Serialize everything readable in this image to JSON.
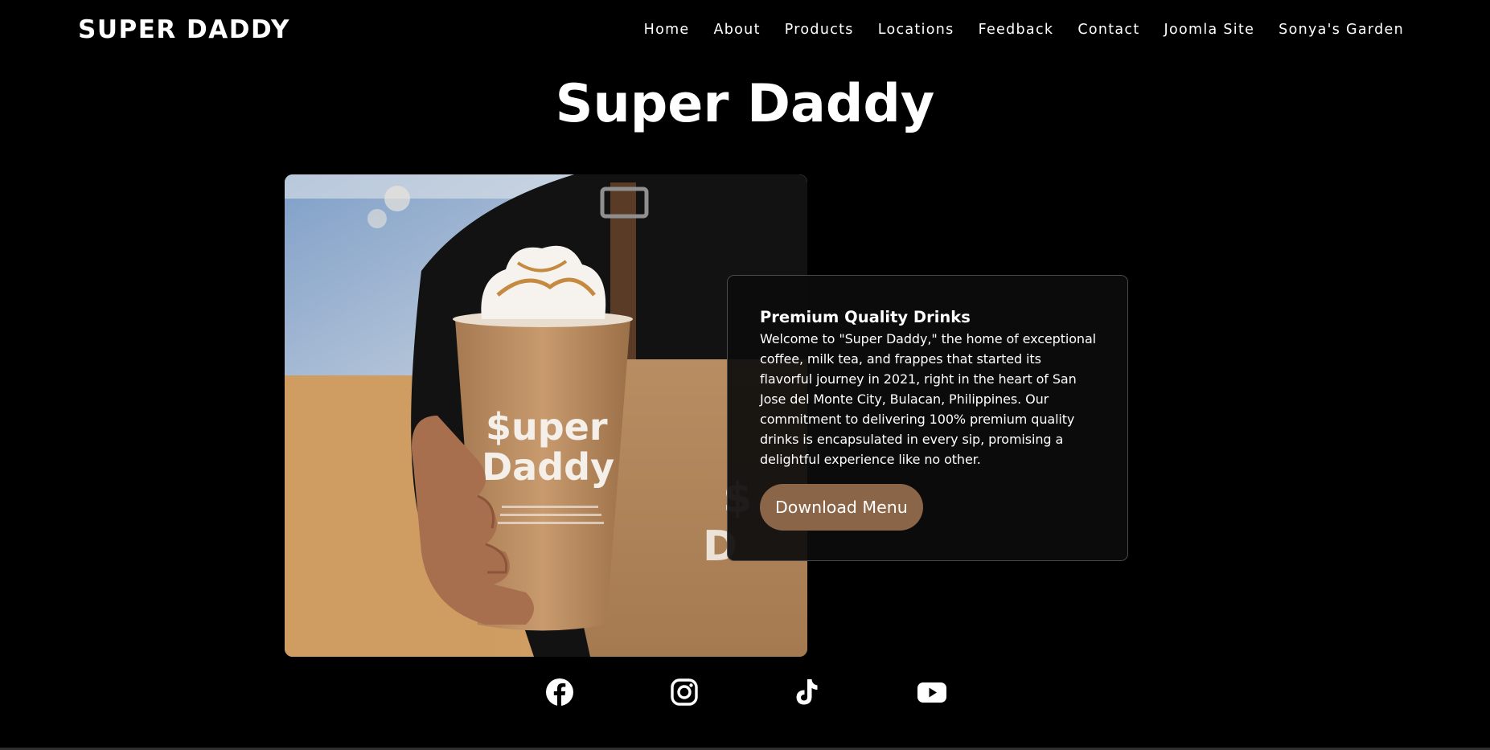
{
  "header": {
    "logo": "SUPER DADDY",
    "nav": [
      "Home",
      "About",
      "Products",
      "Locations",
      "Feedback",
      "Contact",
      "Joomla Site",
      "Sonya's Garden"
    ]
  },
  "main": {
    "title": "Super Daddy",
    "cup_print": {
      "line1": "$uper",
      "line2": "Daddy"
    },
    "card": {
      "heading": "Premium Quality Drinks",
      "body": "Welcome to \"Super Daddy,\" the home of exceptional coffee, milk tea, and frappes that started its flavorful journey in 2021, right in the heart of San Jose del Monte City, Bulacan, Philippines. Our commitment to delivering 100% premium quality drinks is encapsulated in every sip, promising a delightful experience like no other.",
      "button": "Download Menu"
    }
  },
  "social": {
    "icons": [
      "facebook-icon",
      "instagram-icon",
      "tiktok-icon",
      "youtube-icon"
    ]
  },
  "colors": {
    "background": "#000000",
    "button": "#8a6548",
    "card_border": "#4a4a4a"
  }
}
